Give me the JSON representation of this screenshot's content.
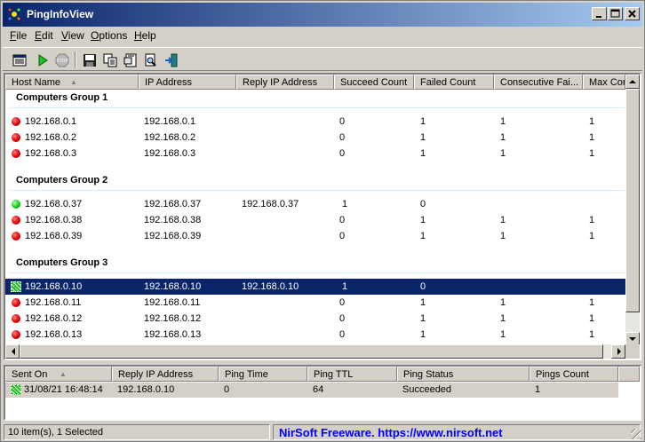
{
  "window": {
    "title": "PingInfoView"
  },
  "menu": [
    "File",
    "Edit",
    "View",
    "Options",
    "Help"
  ],
  "menu_mnemonics": [
    "F",
    "E",
    "V",
    "O",
    "H"
  ],
  "toolbar": {
    "icons": [
      "properties-list-icon",
      "start-ping-icon",
      "stop-icon",
      "save-icon",
      "copy-icon",
      "html-report-icon",
      "find-icon",
      "exit-icon"
    ]
  },
  "top_list": {
    "columns": [
      "Host Name",
      "IP Address",
      "Reply IP Address",
      "Succeed Count",
      "Failed Count",
      "Consecutive Fai...",
      "Max Cons..."
    ],
    "groups": [
      {
        "name": "Computers Group 1",
        "rows": [
          {
            "status": "red",
            "host": "192.168.0.1",
            "ip": "192.168.0.1",
            "reply_ip": "",
            "succeed": "0",
            "failed": "1",
            "consecutive": "1",
            "max": "1"
          },
          {
            "status": "red",
            "host": "192.168.0.2",
            "ip": "192.168.0.2",
            "reply_ip": "",
            "succeed": "0",
            "failed": "1",
            "consecutive": "1",
            "max": "1"
          },
          {
            "status": "red",
            "host": "192.168.0.3",
            "ip": "192.168.0.3",
            "reply_ip": "",
            "succeed": "0",
            "failed": "1",
            "consecutive": "1",
            "max": "1"
          }
        ]
      },
      {
        "name": "Computers Group 2",
        "rows": [
          {
            "status": "green",
            "host": "192.168.0.37",
            "ip": "192.168.0.37",
            "reply_ip": "192.168.0.37",
            "succeed": "1",
            "failed": "0",
            "consecutive": "",
            "max": ""
          },
          {
            "status": "red",
            "host": "192.168.0.38",
            "ip": "192.168.0.38",
            "reply_ip": "",
            "succeed": "0",
            "failed": "1",
            "consecutive": "1",
            "max": "1"
          },
          {
            "status": "red",
            "host": "192.168.0.39",
            "ip": "192.168.0.39",
            "reply_ip": "",
            "succeed": "0",
            "failed": "1",
            "consecutive": "1",
            "max": "1"
          }
        ]
      },
      {
        "name": "Computers Group 3",
        "rows": [
          {
            "status": "selected",
            "host": "192.168.0.10",
            "ip": "192.168.0.10",
            "reply_ip": "192.168.0.10",
            "succeed": "1",
            "failed": "0",
            "consecutive": "",
            "max": ""
          },
          {
            "status": "red",
            "host": "192.168.0.11",
            "ip": "192.168.0.11",
            "reply_ip": "",
            "succeed": "0",
            "failed": "1",
            "consecutive": "1",
            "max": "1"
          },
          {
            "status": "red",
            "host": "192.168.0.12",
            "ip": "192.168.0.12",
            "reply_ip": "",
            "succeed": "0",
            "failed": "1",
            "consecutive": "1",
            "max": "1"
          },
          {
            "status": "red",
            "host": "192.168.0.13",
            "ip": "192.168.0.13",
            "reply_ip": "",
            "succeed": "0",
            "failed": "1",
            "consecutive": "1",
            "max": "1"
          }
        ]
      }
    ]
  },
  "bottom_list": {
    "columns": [
      "Sent On",
      "Reply IP Address",
      "Ping Time",
      "Ping TTL",
      "Ping Status",
      "Pings Count"
    ],
    "rows": [
      {
        "sent_on": "31/08/21 16:48:14",
        "reply_ip": "192.168.0.10",
        "ping_time": "0",
        "ping_ttl": "64",
        "ping_status": "Succeeded",
        "pings_count": "1"
      }
    ]
  },
  "status_bar": {
    "items": "10 item(s), 1 Selected",
    "link": "NirSoft Freeware. https://www.nirsoft.net"
  },
  "colors": {
    "selection": "#0a246a",
    "title_start": "#0a246a",
    "title_end": "#a6caf0",
    "link": "#0000ff",
    "fail": "#e00000",
    "success": "#10d010"
  }
}
